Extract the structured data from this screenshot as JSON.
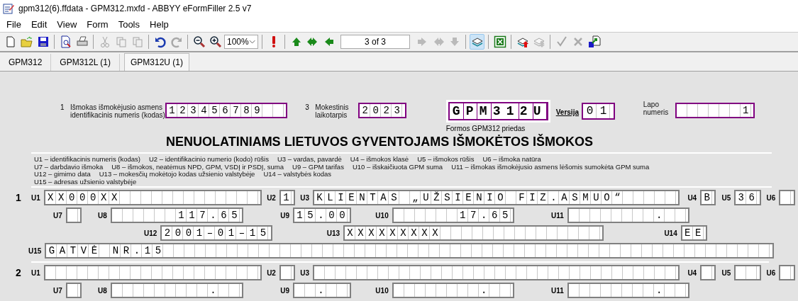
{
  "window": {
    "title": "gpm312(6).ffdata - GPM312.mxfd - ABBYY eFormFiller 2.5 v7"
  },
  "menu": [
    "File",
    "Edit",
    "View",
    "Form",
    "Tools",
    "Help"
  ],
  "toolbar": [
    {
      "kind": "new",
      "disabled": false
    },
    {
      "kind": "open",
      "disabled": false
    },
    {
      "kind": "save",
      "disabled": false
    },
    {
      "kind": "separator"
    },
    {
      "kind": "preview",
      "disabled": false
    },
    {
      "kind": "print",
      "disabled": false
    },
    {
      "kind": "separator"
    },
    {
      "kind": "cut",
      "disabled": true
    },
    {
      "kind": "copy",
      "disabled": true
    },
    {
      "kind": "paste",
      "disabled": true
    },
    {
      "kind": "separator"
    },
    {
      "kind": "undo",
      "disabled": false
    },
    {
      "kind": "redo",
      "disabled": true
    },
    {
      "kind": "separator"
    },
    {
      "kind": "zoom-out",
      "disabled": false
    },
    {
      "kind": "zoom-in",
      "disabled": false
    },
    {
      "kind": "combo",
      "value": "100%"
    },
    {
      "kind": "separator"
    },
    {
      "kind": "alert",
      "disabled": false
    },
    {
      "kind": "separator"
    },
    {
      "kind": "up",
      "disabled": false
    },
    {
      "kind": "first",
      "disabled": false
    },
    {
      "kind": "prev",
      "disabled": false
    },
    {
      "kind": "pagefield",
      "value": "3 of 3"
    },
    {
      "kind": "next",
      "disabled": true
    },
    {
      "kind": "last",
      "disabled": true
    },
    {
      "kind": "down",
      "disabled": true
    },
    {
      "kind": "separator"
    },
    {
      "kind": "layers",
      "disabled": false,
      "selected": true
    },
    {
      "kind": "separator"
    },
    {
      "kind": "excel",
      "disabled": false
    },
    {
      "kind": "separator"
    },
    {
      "kind": "export",
      "disabled": false
    },
    {
      "kind": "import",
      "disabled": true
    },
    {
      "kind": "separator"
    },
    {
      "kind": "check",
      "disabled": true
    },
    {
      "kind": "cancel",
      "disabled": true
    },
    {
      "kind": "send",
      "disabled": false
    }
  ],
  "tabs": [
    {
      "label": "GPM312",
      "selected": false
    },
    {
      "label": "GPM312L (1)",
      "selected": false
    },
    {
      "label": "GPM312U (1)",
      "selected": true
    }
  ],
  "header": {
    "payer_id": {
      "number": "1",
      "label": "Išmokas išmokėjusio asmens identifikacinis numeris (kodas)",
      "value": "123456789"
    },
    "period": {
      "number": "3",
      "label": "Mokestinis laikotarpis",
      "value": "2023"
    },
    "form_code": {
      "value": "GPM312U",
      "caption": "Formos GPM312 priedas"
    },
    "version": {
      "label": "Versija",
      "value": "01"
    },
    "page_number": {
      "label": "Lapo numeris",
      "value": "1"
    }
  },
  "title": "NENUOLATINIAMS LIETUVOS GYVENTOJAMS IŠMOKĖTOS IŠMOKOS",
  "legend": [
    [
      "U1 – identifikacinis numeris (kodas)",
      "U2 – identifikacinio numerio (kodo) rūšis",
      "U3 – vardas, pavardė",
      "U4 – išmokos klasė",
      "U5 – išmokos rūšis",
      "U6 – išmoka natūra"
    ],
    [
      "U7 – darbdavio išmoka",
      "U8 – išmokos, neatėmus NPD, GPM, VSDĮ ir PSDĮ, suma",
      "U9 – GPM tarifas",
      "U10 – išskaičiuota GPM suma",
      "U11 – išmokas išmokėjusio asmens lėšomis sumokėta GPM suma"
    ],
    [
      "U12 – gimimo data",
      "U13 – mokesčių mokėtojo kodas užsienio valstybėje",
      "U14 – valstybės kodas"
    ],
    [
      "U15 – adresas užsienio valstybėje"
    ]
  ],
  "records": [
    {
      "number": "1",
      "lines": [
        [
          {
            "code": "U1",
            "value": "XX000XX"
          },
          {
            "code": "U2",
            "value": "1"
          },
          {
            "code": "U3",
            "value": "KLIENTAS „UŽSIENIO FIZ.ASMUO“"
          },
          {
            "code": "U4",
            "value": "B"
          },
          {
            "code": "U5",
            "value": "36"
          },
          {
            "code": "U6"
          }
        ],
        [
          {
            "code": "U7"
          },
          {
            "code": "U8",
            "value": "117.65"
          },
          {
            "code": "U9",
            "value": "15.00"
          },
          {
            "code": "U10",
            "value": "17.65"
          },
          {
            "code": "U11",
            "value": "."
          }
        ],
        [
          {
            "code": "U12",
            "value": "2001–01–15"
          },
          {
            "code": "U13",
            "value": "XXXXXXXXX"
          },
          {
            "code": "U14",
            "value": "EE"
          }
        ],
        [
          {
            "code": "U15",
            "value": "GATVĖ NR.15"
          }
        ]
      ]
    },
    {
      "number": "2",
      "lines": [
        [
          {
            "code": "U1"
          },
          {
            "code": "U2"
          },
          {
            "code": "U3"
          },
          {
            "code": "U4"
          },
          {
            "code": "U5"
          },
          {
            "code": "U6"
          }
        ],
        [
          {
            "code": "U7"
          },
          {
            "code": "U8",
            "value": "."
          },
          {
            "code": "U9",
            "value": "."
          },
          {
            "code": "U10",
            "value": "."
          },
          {
            "code": "U11",
            "value": "."
          }
        ]
      ]
    }
  ]
}
